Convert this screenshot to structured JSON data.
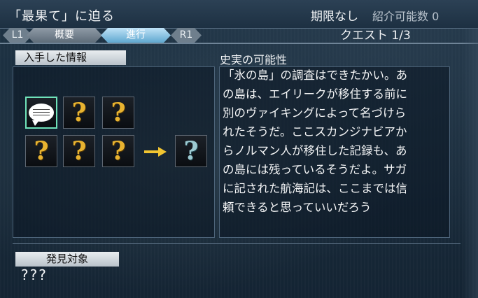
{
  "header": {
    "title": "「最果て」に迫る",
    "deadline": "期限なし",
    "introduce": "紹介可能数 0",
    "quest_count": "クエスト 1/3"
  },
  "tabs": {
    "l1": "L1",
    "overview": "概要",
    "progress": "進行",
    "r1": "R1",
    "active": "進行"
  },
  "info_section": {
    "header": "入手した情報"
  },
  "history": {
    "title": "史実の可能性",
    "lines": [
      "「氷の島」の調査はできたかい。あ",
      "の島は、エイリークが移住する前に",
      "別のヴァイキングによって名づけら",
      "れたそうだ。ここスカンジナビアか",
      "らノルマン人が移住した記録も、あ",
      "の島には残っているそうだよ。サガ",
      "に記された航海記は、ここまでは信",
      "頼できると思っていいだろう"
    ]
  },
  "items": {
    "unknown_glyph": "?",
    "result_glyph": "?"
  },
  "target_section": {
    "header": "発見対象",
    "value": "???"
  },
  "colors": {
    "selected_border": "#6fe2b9",
    "question_gold": "#e8b330",
    "question_blue": "#9ccad2",
    "arrow": "#f1c531"
  },
  "icons": {
    "speech_bubble": "speech-bubble-icon",
    "unknown_item": "question-mark-icon",
    "arrow": "right-arrow-icon"
  }
}
